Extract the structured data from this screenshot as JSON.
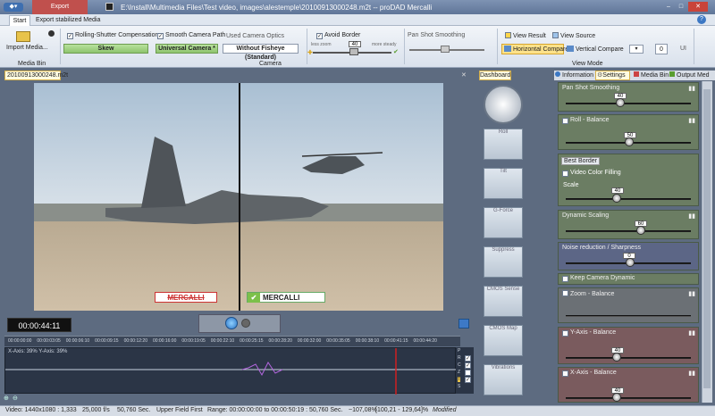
{
  "window": {
    "title": "E:\\Install\\Multimedia Files\\Test video, images\\alestemple\\20100913000248.m2t -- proDAD Mercalli",
    "export_tab": "Export"
  },
  "ribbon_tabs": {
    "start": "Start",
    "export_stabilized": "Export stabilized Media"
  },
  "media_bin": {
    "import_label": "Import Media...",
    "group": "Media Bin"
  },
  "camera": {
    "rolling_shutter": "Rolling-Shutter Compensation",
    "rolling_value": "Skew",
    "smooth_path": "Smooth Camera Path",
    "smooth_value": "Universal Camera *",
    "optics": "Used Camera Optics",
    "optics_value": "Without Fisheye (Standard)",
    "avoid_border": "Avoid Border",
    "avoid_value": "40",
    "less_zoom": "less zoom",
    "more_steady": "more steady",
    "pan_shot": "Pan Shot Smoothing",
    "group": "Camera"
  },
  "view": {
    "view_result": "View Result",
    "view_source": "View Source",
    "horizontal": "Horizontal Compare",
    "vertical": "Vertical Compare",
    "group": "View Mode",
    "spin_value": "0",
    "ui_label": "UI"
  },
  "video": {
    "file_tab": "20100913000248.m2t",
    "logo_left": "MERCALLI",
    "logo_right": "MERCALLI",
    "timecode": "00:00:44:11"
  },
  "timeline": {
    "ticks": [
      "00:00:00:00",
      "00:00:03:05",
      "00:00:06:10",
      "00:00:09:15",
      "00:00:12:20",
      "00:00:16:00",
      "00:00:19:05",
      "00:00:22:10",
      "00:00:25:15",
      "00:00:28:20",
      "00:00:32:00",
      "00:00:35:05",
      "00:00:38:10",
      "00:00:41:15",
      "00:00:44:20"
    ],
    "axis_label": "X-Axis: 39%  Y-Axis: 39%",
    "letters": [
      "P",
      "R",
      "C",
      "Z",
      "T",
      "S"
    ]
  },
  "dashboard": {
    "tab": "Dashboard",
    "buttons": [
      "Roll",
      "Tilt",
      "G-Force",
      "Suppress",
      "CMOS Sense",
      "CMOS Map",
      "Vibrations"
    ]
  },
  "settings": {
    "tabs": [
      "Information",
      "Settings",
      "Media Bin",
      "Output Med"
    ],
    "pan_shot": "Pan Shot Smoothing",
    "pan_val": "40",
    "roll": "Roll - Balance",
    "roll_val": "50",
    "best_border": "Best Border",
    "video_color": "Video Color Filling",
    "scale": "Scale",
    "scale_val": "40",
    "dyn_scaling": "Dynamic Scaling",
    "dyn_val": "60",
    "noise": "Noise reduction / Sharpness",
    "noise_val": "0",
    "keep_dyn": "Keep Camera Dynamic",
    "zoom": "Zoom - Balance",
    "yaxis": "Y-Axis - Balance",
    "yaxis_val": "40",
    "xaxis": "X-Axis - Balance",
    "xaxis_val": "40"
  },
  "status": {
    "video": "Video: 1440x1080 : 1,333",
    "fps": "25,000 f/s",
    "sec": "50,760 Sec.",
    "field": "Upper Field First",
    "range": "Range: 00:00:00:00 to 00:00:50:19 : 50,760 Sec.",
    "zoom": "~107,08%",
    "coords": "[100,21 - 129,64]%",
    "modified": "Modified"
  }
}
